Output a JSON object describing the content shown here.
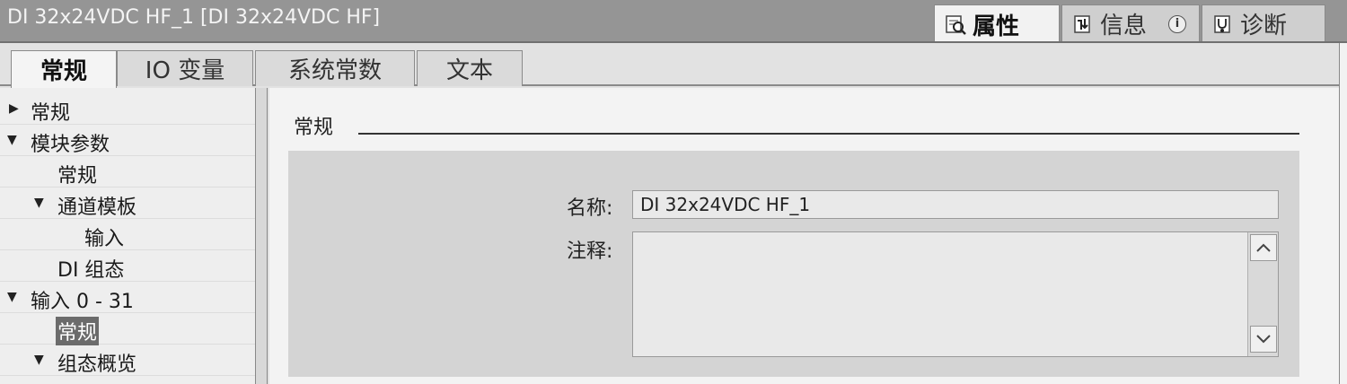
{
  "window": {
    "title": "DI 32x24VDC HF_1 [DI 32x24VDC HF]",
    "tabs": [
      {
        "label": "属性",
        "icon": "properties-icon",
        "active": true
      },
      {
        "label": "信息",
        "icon": "info-icon",
        "badge": "i",
        "active": false
      },
      {
        "label": "诊断",
        "icon": "diagnostics-icon",
        "active": false
      }
    ]
  },
  "subtabs": [
    {
      "label": "常规",
      "active": true
    },
    {
      "label": "IO 变量",
      "active": false
    },
    {
      "label": "系统常数",
      "active": false
    },
    {
      "label": "文本",
      "active": false
    }
  ],
  "tree": {
    "items": [
      {
        "label": "常规",
        "expander": "collapsed",
        "selected": false
      },
      {
        "label": "模块参数",
        "expander": "expanded",
        "selected": false
      },
      {
        "label": "常规",
        "expander": "none",
        "selected": false
      },
      {
        "label": "通道模板",
        "expander": "expanded",
        "selected": false
      },
      {
        "label": "输入",
        "expander": "none",
        "selected": false
      },
      {
        "label": "DI 组态",
        "expander": "none",
        "selected": false
      },
      {
        "label": "输入 0 - 31",
        "expander": "expanded",
        "selected": false
      },
      {
        "label": "常规",
        "expander": "none",
        "selected": true
      },
      {
        "label": "组态概览",
        "expander": "expanded",
        "selected": false
      }
    ]
  },
  "main": {
    "section_title": "常规",
    "name_label": "名称:",
    "name_value": "DI 32x24VDC HF_1",
    "comment_label": "注释:",
    "comment_value": ""
  },
  "colors": {
    "titlebar": "#959595",
    "panel": "#f3f3f3",
    "formbox": "#d4d4d4",
    "selection": "#6b6b6b"
  }
}
